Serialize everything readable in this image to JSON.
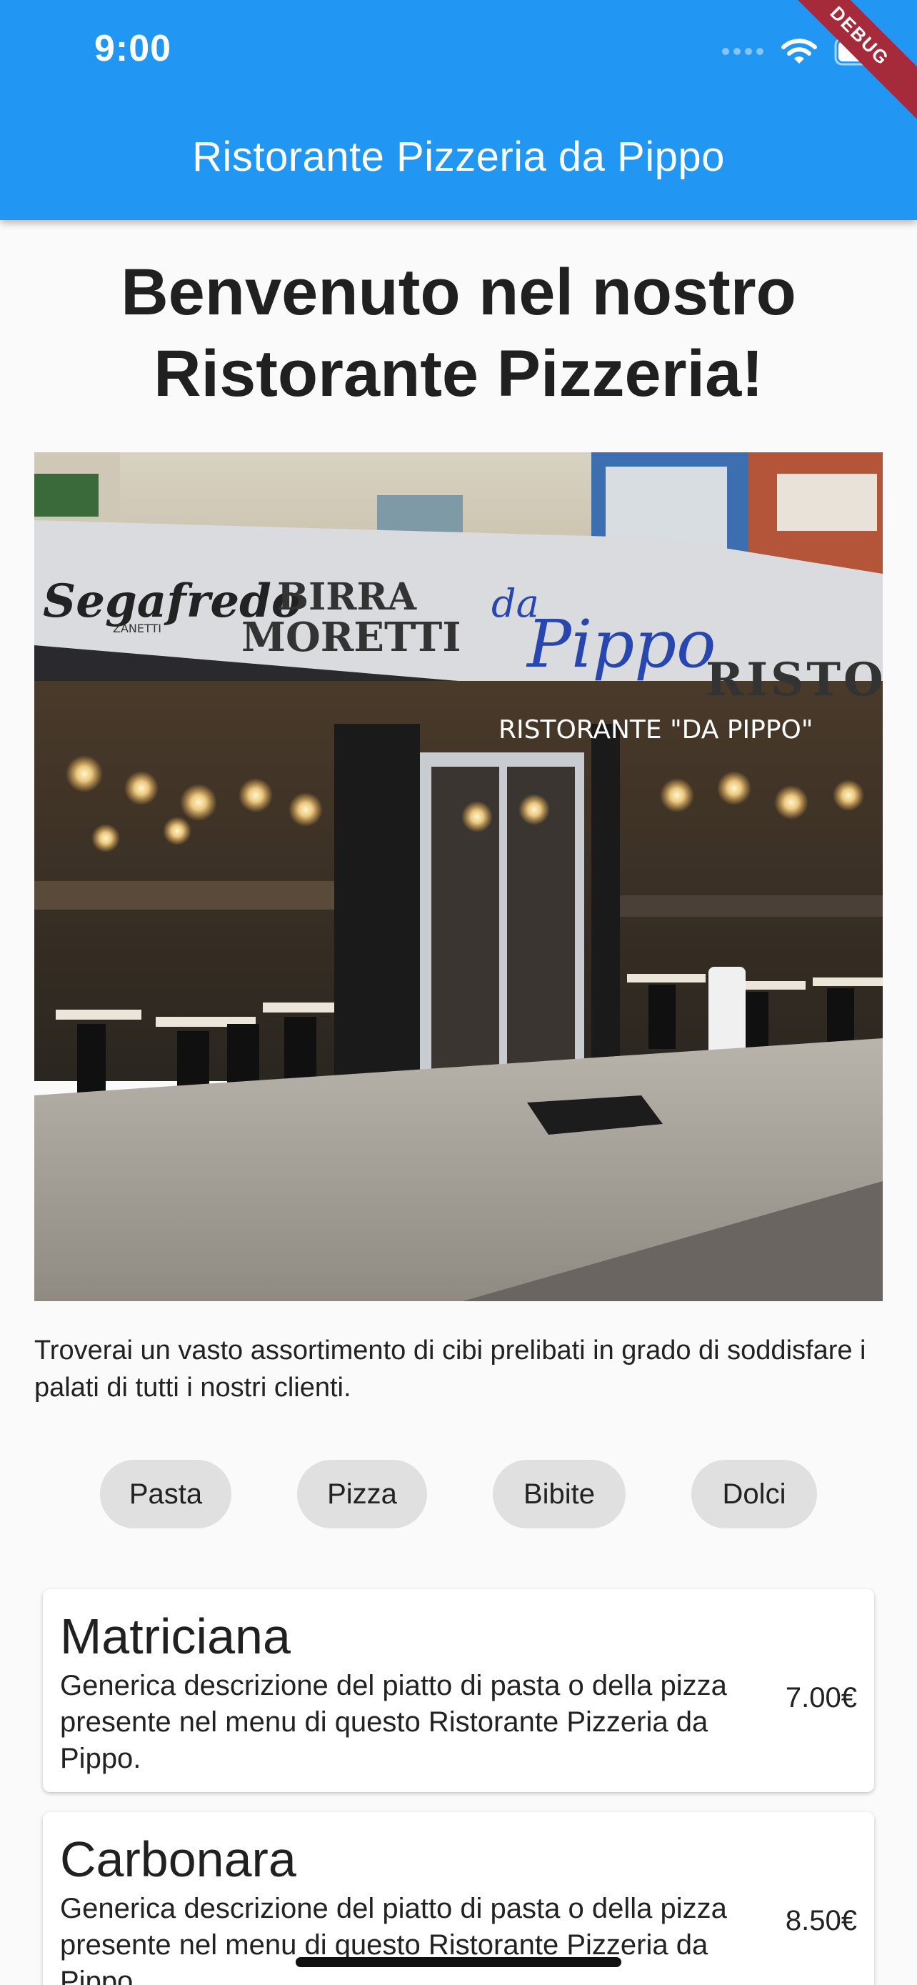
{
  "status_bar": {
    "time": "9:00",
    "icons": [
      "signal-dots-icon",
      "wifi-icon",
      "battery-icon"
    ]
  },
  "debug_banner": "DEBUG",
  "app_bar": {
    "title": "Ristorante Pizzeria da Pippo",
    "color": "#2196f3"
  },
  "welcome": {
    "line1": "Benvenuto nel nostro",
    "line2": "Ristorante Pizzeria!"
  },
  "hero_image": {
    "signs": [
      "Segafredo",
      "ZANETTI",
      "BIRRA",
      "MORETTI",
      "da",
      "Pippo",
      "RISTORA",
      "RISTORANTE \"DA PIPPO\""
    ]
  },
  "intro": "Troverai un vasto assortimento di cibi prelibati in grado di soddisfare i palati di tutti i nostri clienti.",
  "categories": [
    {
      "label": "Pasta"
    },
    {
      "label": "Pizza"
    },
    {
      "label": "Bibite"
    },
    {
      "label": "Dolci"
    }
  ],
  "menu": [
    {
      "name": "Matriciana",
      "description": "Generica descrizione del piatto di pasta o della pizza presente nel menu di questo Ristorante Pizzeria da Pippo.",
      "price": "7.00€"
    },
    {
      "name": "Carbonara",
      "description": "Generica descrizione del piatto di pasta o della pizza presente nel menu di questo Ristorante Pizzeria da Pippo.",
      "price": "8.50€"
    }
  ]
}
